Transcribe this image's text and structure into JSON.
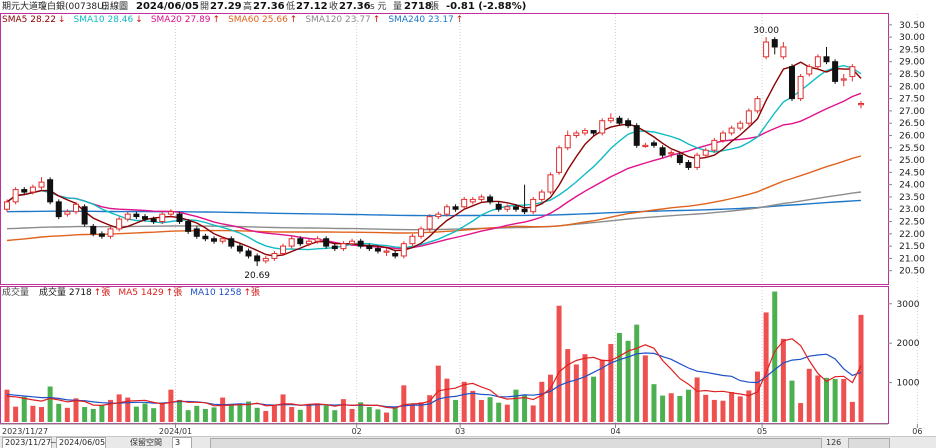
{
  "header": {
    "name": "期元大道瓊白銀(00738U)",
    "period": "日線圖",
    "date": "2024/06/05",
    "open_label": "開",
    "open": "27.29",
    "high_label": "高",
    "high": "27.36",
    "low_label": "低",
    "low": "27.12",
    "close_label": "收",
    "close": "27.36",
    "close_suffix": "s 元",
    "volume_label": "量",
    "volume": "2718",
    "volume_unit": "張",
    "change": "-0.81 (-2.88%)"
  },
  "price_legend": [
    {
      "label": "SMA5",
      "value": "28.22",
      "arrow": "↓",
      "color": "#8b0000"
    },
    {
      "label": "SMA10",
      "value": "28.46",
      "arrow": "↓",
      "color": "#11bcc4"
    },
    {
      "label": "SMA20",
      "value": "27.89",
      "arrow": "↑",
      "color": "#e0128c"
    },
    {
      "label": "SMA60",
      "value": "25.66",
      "arrow": "↑",
      "color": "#e0641e"
    },
    {
      "label": "SMA120",
      "value": "23.77",
      "arrow": "↑",
      "color": "#8c8c8c"
    },
    {
      "label": "SMA240",
      "value": "23.17",
      "arrow": "↑",
      "color": "#1e78c8"
    }
  ],
  "volume_legend": [
    {
      "label": "成交量",
      "value": "",
      "arrow": "",
      "color": "#444444"
    },
    {
      "label": "成交量",
      "value": "2718",
      "arrow": "↑張",
      "color": "#111111"
    },
    {
      "label": "MA5",
      "value": "1429",
      "arrow": "↑張",
      "color": "#e02020"
    },
    {
      "label": "MA10",
      "value": "1258",
      "arrow": "↑張",
      "color": "#1e50c8"
    }
  ],
  "chart_data": [
    {
      "type": "candlestick",
      "title": "期元大道瓊白銀(00738U) 日線圖",
      "ylim": [
        20.0,
        30.9
      ],
      "y_ticks": [
        "30.50",
        "30.00",
        "29.50",
        "29.00",
        "28.50",
        "28.00",
        "27.50",
        "27.00",
        "26.50",
        "26.00",
        "25.50",
        "25.00",
        "24.50",
        "24.00",
        "23.50",
        "23.00",
        "22.50",
        "22.00",
        "21.50",
        "21.00",
        "20.50"
      ],
      "annotations": [
        {
          "text": "30.00",
          "value": 30.0
        },
        {
          "text": "20.69",
          "value": 20.69
        }
      ],
      "close": [
        23.3,
        23.8,
        23.7,
        23.9,
        24.1,
        23.3,
        22.7,
        22.9,
        23.2,
        22.4,
        22.0,
        21.9,
        22.2,
        22.6,
        22.8,
        22.7,
        22.6,
        22.5,
        22.8,
        22.9,
        22.5,
        22.1,
        21.9,
        21.8,
        21.7,
        21.8,
        21.5,
        21.3,
        21.1,
        20.9,
        21.0,
        21.2,
        21.5,
        21.8,
        21.6,
        21.7,
        21.8,
        21.5,
        21.4,
        21.6,
        21.7,
        21.5,
        21.4,
        21.3,
        21.3,
        21.1,
        21.6,
        21.9,
        22.2,
        22.7,
        22.8,
        23.1,
        23.0,
        23.4,
        23.4,
        23.5,
        23.3,
        23.0,
        23.1,
        23.0,
        22.9,
        23.4,
        23.7,
        24.4,
        25.5,
        26.0,
        26.1,
        26.2,
        26.1,
        26.6,
        26.7,
        26.5,
        26.4,
        25.6,
        25.6,
        25.6,
        25.2,
        25.3,
        24.9,
        24.7,
        25.2,
        25.4,
        25.8,
        26.1,
        26.3,
        26.5,
        27.0,
        27.5,
        29.8,
        29.6,
        29.6,
        27.5,
        28.4,
        28.8,
        29.2,
        29.0,
        28.2,
        28.3,
        28.8,
        27.3
      ],
      "open": [
        23.0,
        23.3,
        23.8,
        23.7,
        23.9,
        24.2,
        23.3,
        22.8,
        22.9,
        23.1,
        22.3,
        22.0,
        21.9,
        22.2,
        22.6,
        22.8,
        22.7,
        22.6,
        22.5,
        22.8,
        22.8,
        22.5,
        22.2,
        21.9,
        21.8,
        21.7,
        21.8,
        21.5,
        21.3,
        21.1,
        20.9,
        21.0,
        21.2,
        21.5,
        21.8,
        21.6,
        21.7,
        21.8,
        21.5,
        21.4,
        21.6,
        21.7,
        21.5,
        21.4,
        21.3,
        21.2,
        21.1,
        21.6,
        21.9,
        22.2,
        22.7,
        22.8,
        23.1,
        23.1,
        23.3,
        23.4,
        23.5,
        23.2,
        23.0,
        23.1,
        23.0,
        22.9,
        23.4,
        23.7,
        24.5,
        25.5,
        26.0,
        26.1,
        26.2,
        26.1,
        26.6,
        26.7,
        26.6,
        26.4,
        25.6,
        25.7,
        25.5,
        25.3,
        25.2,
        24.9,
        24.7,
        25.2,
        25.4,
        25.8,
        26.1,
        26.3,
        26.5,
        27.0,
        29.2,
        29.9,
        29.2,
        28.8,
        27.5,
        28.5,
        28.8,
        29.2,
        29.0,
        28.3,
        28.4,
        27.3
      ],
      "high": [
        23.4,
        23.9,
        23.9,
        24.0,
        24.3,
        24.3,
        23.4,
        23.0,
        23.3,
        23.2,
        22.4,
        22.1,
        22.3,
        22.7,
        22.9,
        22.9,
        22.8,
        22.7,
        22.9,
        23.0,
        22.9,
        22.6,
        22.3,
        22.0,
        21.9,
        21.9,
        21.9,
        21.6,
        21.4,
        21.2,
        21.1,
        21.3,
        21.6,
        21.9,
        21.9,
        21.8,
        21.9,
        21.9,
        21.6,
        21.7,
        21.8,
        21.8,
        21.6,
        21.5,
        21.4,
        21.3,
        21.7,
        22.0,
        22.3,
        22.8,
        22.9,
        23.2,
        23.2,
        23.5,
        23.5,
        23.6,
        23.6,
        23.3,
        23.2,
        23.2,
        24.0,
        23.5,
        23.8,
        24.5,
        25.6,
        26.2,
        26.2,
        26.3,
        26.2,
        26.7,
        26.9,
        26.8,
        26.7,
        26.5,
        25.7,
        25.8,
        25.6,
        25.4,
        25.3,
        25.0,
        25.3,
        25.5,
        25.9,
        26.2,
        26.4,
        26.6,
        27.1,
        27.6,
        30.0,
        30.0,
        29.8,
        28.9,
        28.5,
        28.9,
        29.3,
        29.6,
        29.1,
        28.5,
        28.9,
        27.4
      ],
      "low": [
        22.9,
        23.2,
        23.6,
        23.6,
        23.8,
        23.2,
        22.6,
        22.7,
        22.8,
        22.3,
        21.9,
        21.8,
        21.8,
        22.1,
        22.5,
        22.6,
        22.5,
        22.4,
        22.4,
        22.7,
        22.4,
        22.0,
        21.8,
        21.7,
        21.6,
        21.6,
        21.4,
        21.2,
        21.0,
        20.69,
        20.8,
        20.9,
        21.1,
        21.4,
        21.5,
        21.5,
        21.6,
        21.4,
        21.3,
        21.3,
        21.5,
        21.4,
        21.3,
        21.2,
        21.1,
        21.0,
        21.0,
        21.5,
        21.8,
        22.1,
        22.6,
        22.7,
        22.9,
        23.0,
        23.2,
        23.3,
        23.2,
        22.9,
        22.9,
        22.9,
        22.8,
        22.8,
        23.3,
        23.6,
        24.4,
        25.4,
        25.9,
        26.0,
        26.0,
        26.0,
        26.5,
        26.4,
        26.3,
        25.5,
        25.5,
        25.5,
        25.1,
        25.1,
        24.8,
        24.6,
        24.6,
        25.1,
        25.3,
        25.7,
        26.0,
        26.2,
        26.4,
        26.9,
        29.1,
        29.3,
        29.1,
        27.4,
        27.4,
        28.4,
        28.7,
        28.9,
        28.1,
        28.0,
        28.2,
        27.1
      ]
    },
    {
      "type": "bar",
      "title": "成交量",
      "ylim": [
        0,
        3400
      ],
      "y_ticks": [
        "3000",
        "2000",
        "1000"
      ],
      "volume": [
        820,
        390,
        640,
        410,
        380,
        900,
        460,
        360,
        600,
        380,
        330,
        420,
        560,
        700,
        620,
        390,
        470,
        350,
        480,
        820,
        560,
        300,
        410,
        330,
        370,
        620,
        420,
        460,
        520,
        360,
        280,
        440,
        700,
        380,
        310,
        450,
        470,
        420,
        300,
        580,
        330,
        500,
        380,
        320,
        240,
        350,
        930,
        420,
        500,
        680,
        1430,
        1100,
        560,
        1020,
        790,
        560,
        630,
        490,
        440,
        820,
        700,
        420,
        1020,
        1200,
        2950,
        1850,
        1460,
        1720,
        1150,
        1580,
        1980,
        2260,
        2060,
        2470,
        1690,
        960,
        670,
        730,
        660,
        820,
        1130,
        690,
        560,
        540,
        760,
        650,
        800,
        1280,
        2780,
        3310,
        2110,
        1050,
        480,
        1350,
        1180,
        1120,
        1090,
        1090,
        510,
        2718
      ],
      "ma5": [
        650,
        640,
        600,
        560,
        530,
        600,
        560,
        510,
        540,
        520,
        430,
        420,
        460,
        490,
        530,
        540,
        550,
        500,
        460,
        500,
        540,
        500,
        500,
        490,
        410,
        420,
        430,
        440,
        440,
        480,
        410,
        420,
        460,
        460,
        420,
        450,
        460,
        440,
        400,
        440,
        420,
        440,
        420,
        420,
        370,
        350,
        440,
        460,
        470,
        530,
        790,
        830,
        860,
        950,
        980,
        890,
        810,
        640,
        580,
        600,
        620,
        570,
        680,
        850,
        1270,
        1450,
        1560,
        1620,
        1640,
        1560,
        1560,
        1670,
        1800,
        1870,
        1960,
        1870,
        1560,
        1340,
        1100,
        960,
        780,
        800,
        770,
        780,
        740,
        710,
        670,
        760,
        1250,
        1790,
        2060,
        2110,
        1940,
        1560,
        1230,
        1030,
        1150,
        1160,
        1000,
        1429
      ],
      "ma10": [
        700,
        680,
        660,
        640,
        620,
        620,
        600,
        560,
        550,
        540,
        510,
        490,
        480,
        480,
        490,
        500,
        500,
        480,
        480,
        500,
        520,
        520,
        510,
        490,
        450,
        440,
        450,
        460,
        450,
        470,
        440,
        430,
        440,
        440,
        430,
        430,
        440,
        440,
        430,
        440,
        420,
        430,
        420,
        420,
        390,
        380,
        410,
        430,
        430,
        460,
        580,
        630,
        650,
        700,
        730,
        700,
        690,
        640,
        640,
        660,
        690,
        680,
        710,
        780,
        920,
        1010,
        1070,
        1150,
        1260,
        1370,
        1500,
        1580,
        1650,
        1730,
        1750,
        1740,
        1660,
        1590,
        1480,
        1370,
        1290,
        1260,
        1220,
        1180,
        1160,
        1050,
        1010,
        1000,
        1150,
        1330,
        1500,
        1570,
        1590,
        1670,
        1700,
        1720,
        1600,
        1350,
        1180,
        1258
      ]
    }
  ],
  "x_axis": {
    "labels": [
      {
        "text": "2023/11/27",
        "index": 0
      },
      {
        "text": "2024/01",
        "index": 20
      },
      {
        "text": "02",
        "index": 41
      },
      {
        "text": "03",
        "index": 53
      },
      {
        "text": "04",
        "index": 71
      },
      {
        "text": "05",
        "index": 88
      },
      {
        "text": "06",
        "index": 106
      }
    ]
  },
  "toolbar": {
    "start_date": "2023/11/27",
    "end_date": "2024/06/05",
    "label": "保留空間",
    "value": "3",
    "count": "126"
  }
}
